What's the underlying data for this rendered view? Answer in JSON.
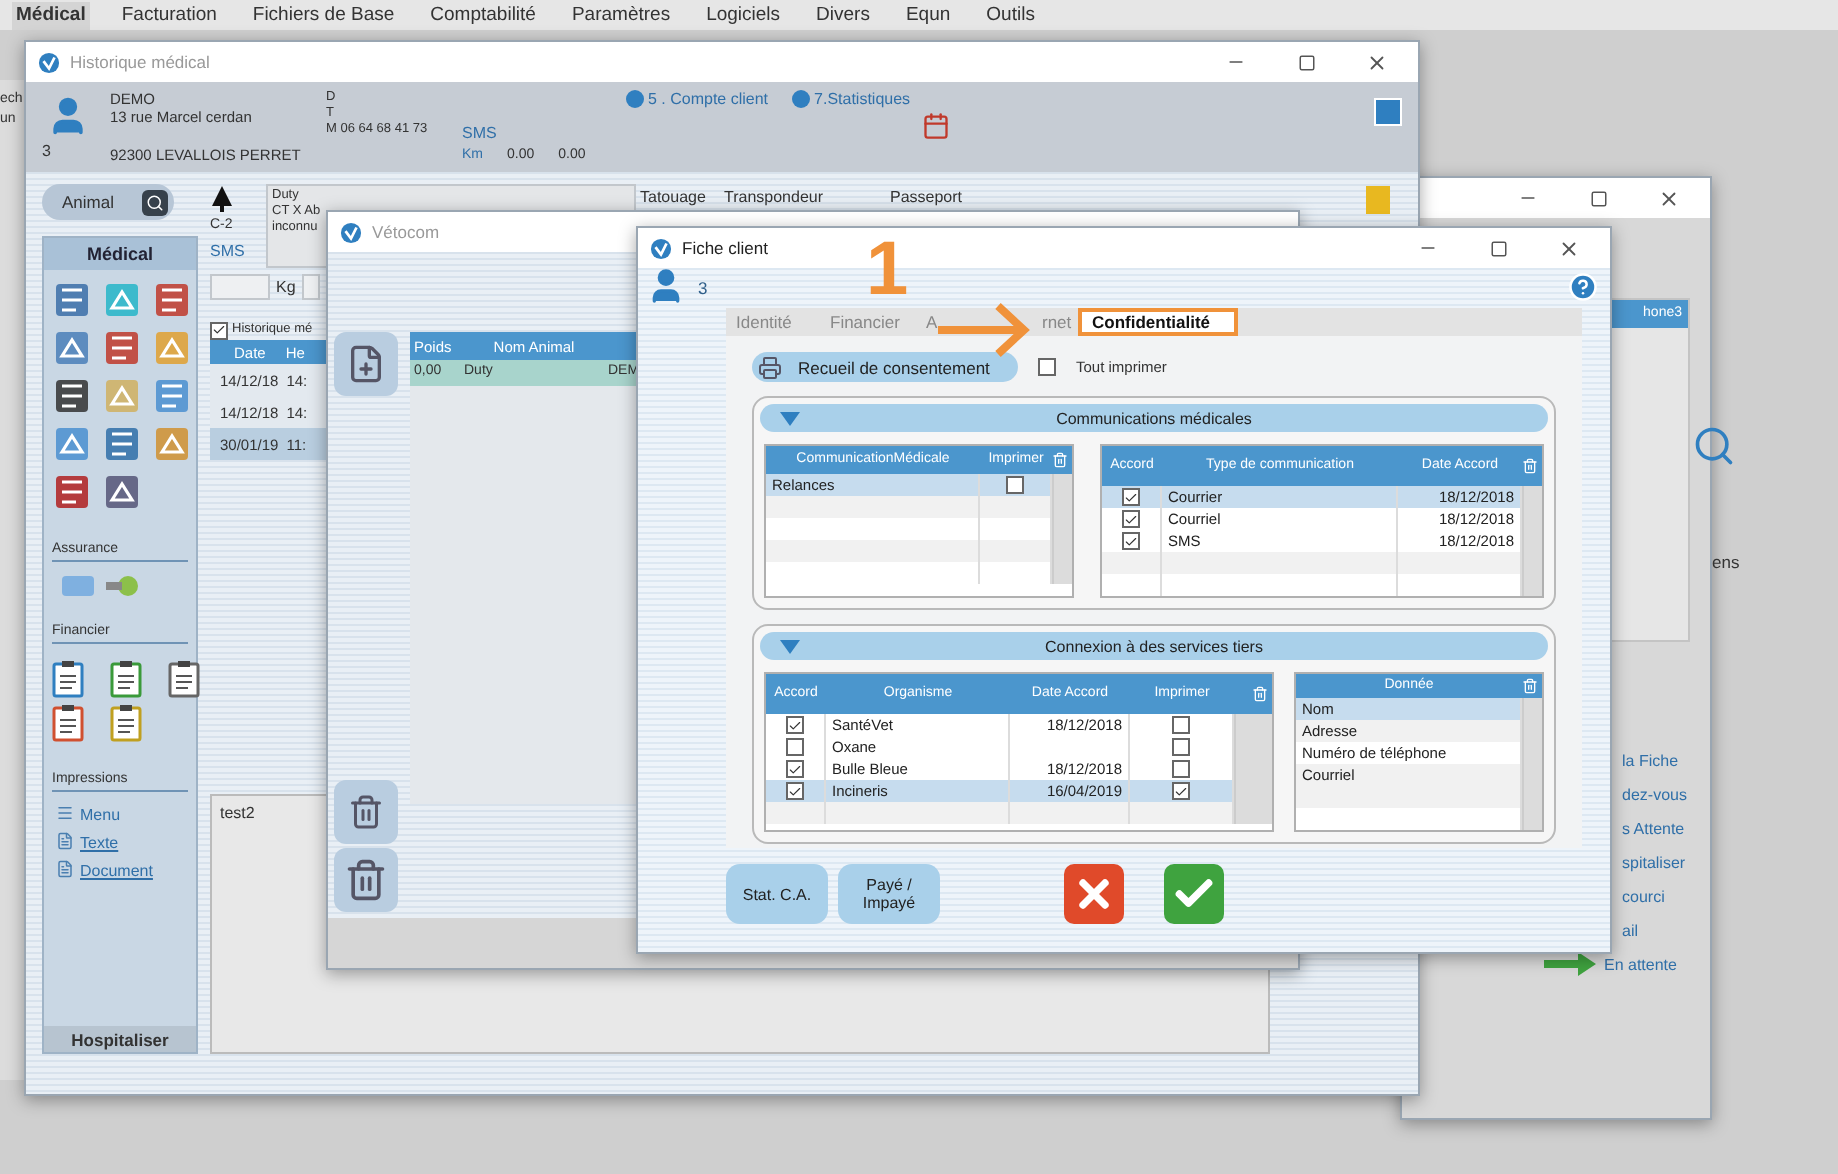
{
  "menu_bar": [
    {
      "label": "Médical",
      "selected": true
    },
    {
      "label": "Facturation",
      "selected": false
    },
    {
      "label": "Fichiers de Base",
      "selected": false
    },
    {
      "label": "Comptabilité",
      "selected": false
    },
    {
      "label": "Paramètres",
      "selected": false
    },
    {
      "label": "Logiciels",
      "selected": false
    },
    {
      "label": "Divers",
      "selected": false
    },
    {
      "label": "Equn",
      "selected": false
    },
    {
      "label": "Outils",
      "selected": false
    }
  ],
  "background_edge_texts": [
    "ech",
    "un"
  ],
  "historique": {
    "title": "Historique médical",
    "client": {
      "name": "DEMO",
      "street": "13 rue Marcel cerdan",
      "number": "3",
      "city": "92300 LEVALLOIS PERRET",
      "phones": [
        "D",
        "T",
        "M 06 64 68 41 73"
      ],
      "sms": "SMS",
      "km_label": "Km",
      "km_values": [
        "0.00",
        "0.00"
      ]
    },
    "links": [
      "5 . Compte client",
      "7.Statistiques"
    ],
    "animal_search": {
      "label": "Animal"
    },
    "sidebar": {
      "title": "Médical",
      "sections": [
        "Assurance",
        "Financier",
        "Impressions"
      ],
      "print_links": [
        "Menu",
        "Texte",
        "Document"
      ],
      "footer": "Hospitaliser"
    },
    "animal": {
      "code": "C-2",
      "sms": "SMS",
      "weight_unit": "Kg",
      "note_lines": [
        "Duty",
        "CT X Ab",
        "inconnu"
      ]
    },
    "id_columns": [
      "Tatouage",
      "Transpondeur",
      "Passeport"
    ],
    "history": {
      "toggle": {
        "label": "Historique mé",
        "checked": true
      },
      "columns": [
        "Date",
        "He"
      ],
      "rows": [
        {
          "date": "14/12/18",
          "time": "14:",
          "selected": false
        },
        {
          "date": "14/12/18",
          "time": "14:",
          "selected": false
        },
        {
          "date": "30/01/19",
          "time": "11:",
          "selected": true
        }
      ]
    },
    "note": "test2"
  },
  "vetocom": {
    "title": "Vétocom",
    "columns": [
      "Poids",
      "Nom Animal"
    ],
    "rows": [
      {
        "cells": [
          "0,00",
          "Duty",
          "DEM"
        ],
        "selected": true
      }
    ]
  },
  "fiche_client": {
    "title": "Fiche client",
    "client_number": "3",
    "annotation": "1",
    "tabs": [
      {
        "label": "Identité",
        "selected": false
      },
      {
        "label": "Financier",
        "selected": false
      },
      {
        "label": "A",
        "selected": false
      },
      {
        "label": "rnet",
        "selected": false
      },
      {
        "label": "Confidentialité",
        "selected": true
      }
    ],
    "consent_button": "Recueil de consentement",
    "print_all": {
      "label": "Tout imprimer",
      "checked": false
    },
    "medical": {
      "title": "Communications médicales",
      "left_columns": [
        "CommunicationMédicale",
        "Imprimer"
      ],
      "left_rows": [
        {
          "name": "Relances",
          "print": false,
          "selected": true
        }
      ],
      "right_columns": [
        "Accord",
        "Type de communication",
        "Date Accord"
      ],
      "right_rows": [
        {
          "accord": true,
          "type": "Courrier",
          "date": "18/12/2018",
          "selected": true
        },
        {
          "accord": true,
          "type": "Courriel",
          "date": "18/12/2018",
          "selected": false
        },
        {
          "accord": true,
          "type": "SMS",
          "date": "18/12/2018",
          "selected": false
        }
      ]
    },
    "services": {
      "title": "Connexion à des services tiers",
      "columns": [
        "Accord",
        "Organisme",
        "Date Accord",
        "Imprimer"
      ],
      "rows": [
        {
          "accord": true,
          "name": "SantéVet",
          "date": "18/12/2018",
          "print": false,
          "selected": false
        },
        {
          "accord": false,
          "name": "Oxane",
          "print": false,
          "selected": false
        },
        {
          "accord": true,
          "name": "Bulle Bleue",
          "date": "18/12/2018",
          "print": false,
          "selected": false
        },
        {
          "accord": true,
          "name": "Incineris",
          "date": "16/04/2019",
          "print": true,
          "selected": true
        }
      ],
      "data_column": "Donnée",
      "data_rows": [
        {
          "label": "Nom",
          "selected": true
        },
        {
          "label": "Adresse",
          "selected": false
        },
        {
          "label": "Numéro de téléphone",
          "selected": false
        },
        {
          "label": "Courriel",
          "selected": false
        }
      ]
    },
    "buttons": [
      "Stat. C.A.",
      "Payé / Impayé"
    ]
  },
  "back_window": {
    "column": "hone3",
    "side_text": "ens",
    "links": [
      "la Fiche",
      "dez-vous",
      "s Attente",
      "spitaliser",
      "courci",
      "ail"
    ],
    "waiting": "En attente"
  }
}
